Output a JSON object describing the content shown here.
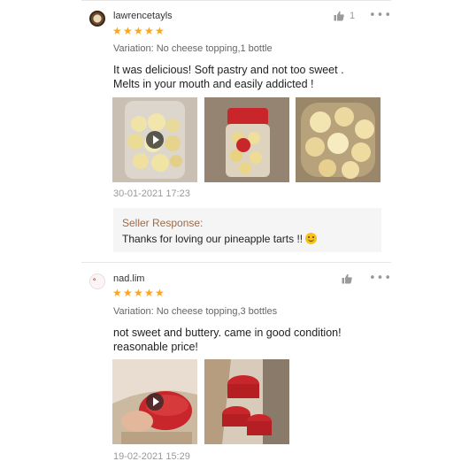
{
  "reviews": [
    {
      "username": "lawrencetayls",
      "rating": 5,
      "likes": "1",
      "variation": "Variation: No cheese topping,1 bottle",
      "comment_line1": "It was delicious! Soft pastry and not too sweet .",
      "comment_line2": "Melts in your mouth and easily addicted !",
      "date": "30-01-2021 17:23",
      "seller_response_title": "Seller Response:",
      "seller_response_text": "Thanks for loving our pineapple tarts !!",
      "photos": [
        "video-jar-of-tarts",
        "jar-with-red-lid",
        "tarts-closeup"
      ]
    },
    {
      "username": "nad.lim",
      "rating": 5,
      "likes": "",
      "variation": "Variation: No cheese topping,3 bottles",
      "comment_line1": "not sweet and buttery. came in good condition!",
      "comment_line2": "reasonable price!",
      "date": "19-02-2021 15:29",
      "photos": [
        "video-red-lids-in-bag",
        "red-lids-in-bag"
      ]
    }
  ],
  "icons": {
    "like": "thumbs-up-icon",
    "more": "more-dots-icon",
    "play": "play-icon",
    "star": "star-icon",
    "emoji": "smile-emoji-icon"
  },
  "colors": {
    "star": "#f5a623",
    "seller_title": "#9a6b4a",
    "lid_red": "#c8262b"
  }
}
